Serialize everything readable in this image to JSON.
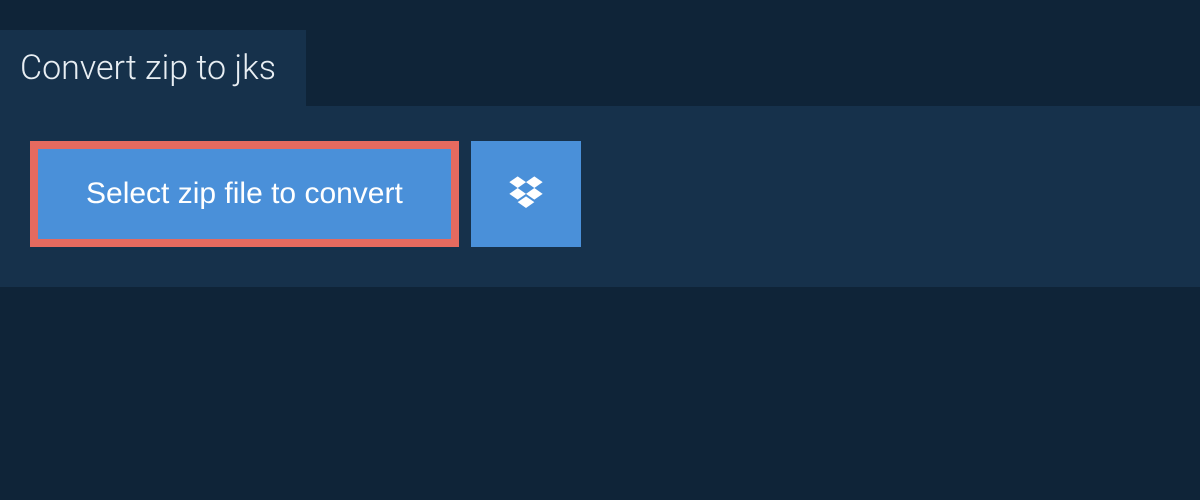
{
  "tab": {
    "title": "Convert zip to jks"
  },
  "main": {
    "select_button_label": "Select zip file to convert",
    "dropbox_icon": "dropbox-icon"
  },
  "colors": {
    "background": "#0f2438",
    "panel": "#16314b",
    "button": "#4a90d9",
    "highlight_border": "#e56a5f",
    "text_light": "#e8eef3",
    "text_white": "#ffffff"
  }
}
